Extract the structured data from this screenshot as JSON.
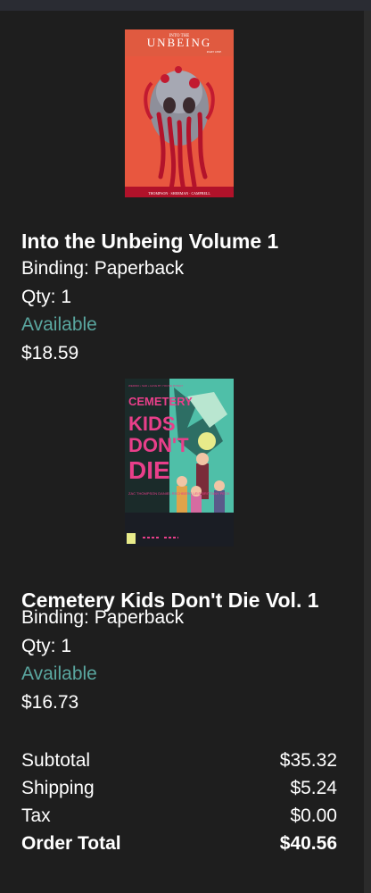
{
  "items": [
    {
      "title": "Into the Unbeing Volume 1",
      "binding": "Binding: Paperback",
      "qty": "Qty: 1",
      "availability": "Available",
      "price": "$18.59",
      "cover": {
        "title_small": "INTO THE",
        "title_large": "UNBEING",
        "subtitle": "PART ONE",
        "credits": "THOMPSON · SHERMAN · CAMPBELL"
      }
    },
    {
      "title": "Cemetery Kids Don't Die Vol. 1",
      "binding": "Binding: Paperback",
      "qty": "Qty: 1",
      "availability": "Available",
      "price": "$16.73",
      "cover": {
        "tagline": "WEIRDO • SAD • ALIVE\nBY YOU'RE DYING?",
        "title_l1": "CEMETERY",
        "title_l2": "KIDS",
        "title_l3": "DON'T",
        "title_l4": "DIE",
        "credits": "ZAC THOMPSON\nDANIEL RECHBERG\nLEIS\nBRITTANY PECK"
      }
    }
  ],
  "summary": {
    "subtotal_label": "Subtotal",
    "subtotal_value": "$35.32",
    "shipping_label": "Shipping",
    "shipping_value": "$5.24",
    "tax_label": "Tax",
    "tax_value": "$0.00",
    "total_label": "Order Total",
    "total_value": "$40.56"
  },
  "colors": {
    "background": "#1e1e1e",
    "available": "#5aa7a0",
    "text": "#ffffff"
  }
}
